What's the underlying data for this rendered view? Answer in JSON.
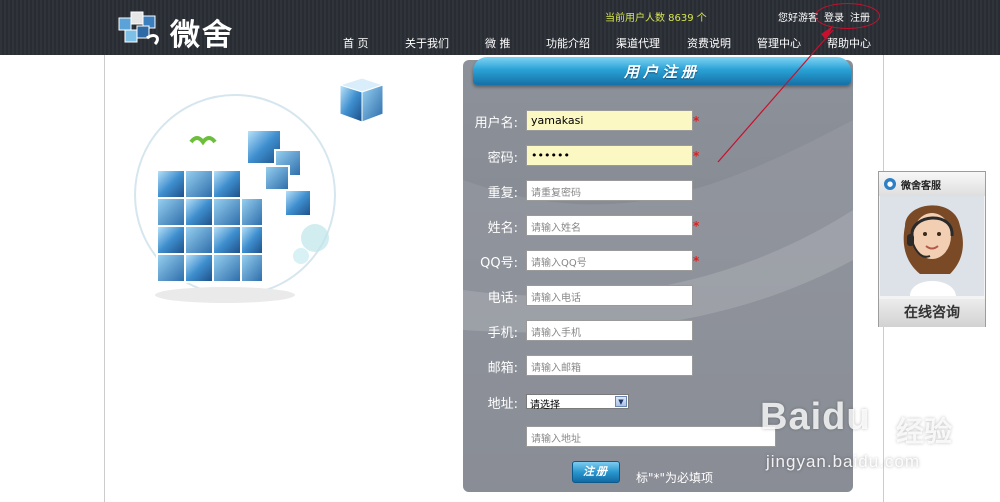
{
  "header": {
    "brand": "微舍",
    "user_count": "当前用户人数 8639 个",
    "greeting": "您好游客",
    "login": "登录",
    "register": "注册",
    "nav": [
      "首 页",
      "关于我们",
      "微 推",
      "功能介绍",
      "渠道代理",
      "资费说明",
      "管理中心",
      "帮助中心"
    ]
  },
  "form": {
    "title": "用户注册",
    "fields": [
      {
        "label": "用户名:",
        "value": "yamakasi",
        "placeholder": "",
        "required": true
      },
      {
        "label": "密码:",
        "value": "••••••",
        "placeholder": "",
        "required": true
      },
      {
        "label": "重复:",
        "value": "",
        "placeholder": "请重复密码",
        "required": false
      },
      {
        "label": "姓名:",
        "value": "",
        "placeholder": "请输入姓名",
        "required": true
      },
      {
        "label": "QQ号:",
        "value": "",
        "placeholder": "请输入QQ号",
        "required": true
      },
      {
        "label": "电话:",
        "value": "",
        "placeholder": "请输入电话",
        "required": false
      },
      {
        "label": "手机:",
        "value": "",
        "placeholder": "请输入手机",
        "required": false
      },
      {
        "label": "邮箱:",
        "value": "",
        "placeholder": "请输入邮箱",
        "required": false
      }
    ],
    "address_label": "地址:",
    "address_select": "请选择",
    "address_placeholder": "请输入地址",
    "required_mark": "*",
    "submit": "注册",
    "note": "标\"*\"为必填项"
  },
  "customer_service": {
    "title": "微舍客服",
    "online": "在线咨询"
  },
  "watermark": {
    "brand": "Baidu",
    "cn": "经验",
    "url": "jingyan.baidu.com"
  },
  "colors": {
    "header_bg": "#2b2f36",
    "user_count": "#d6e64f",
    "panel": "#8d9199",
    "banner": "#2aa2d6",
    "required": "#e02020",
    "filled_field": "#fbf8c4"
  }
}
